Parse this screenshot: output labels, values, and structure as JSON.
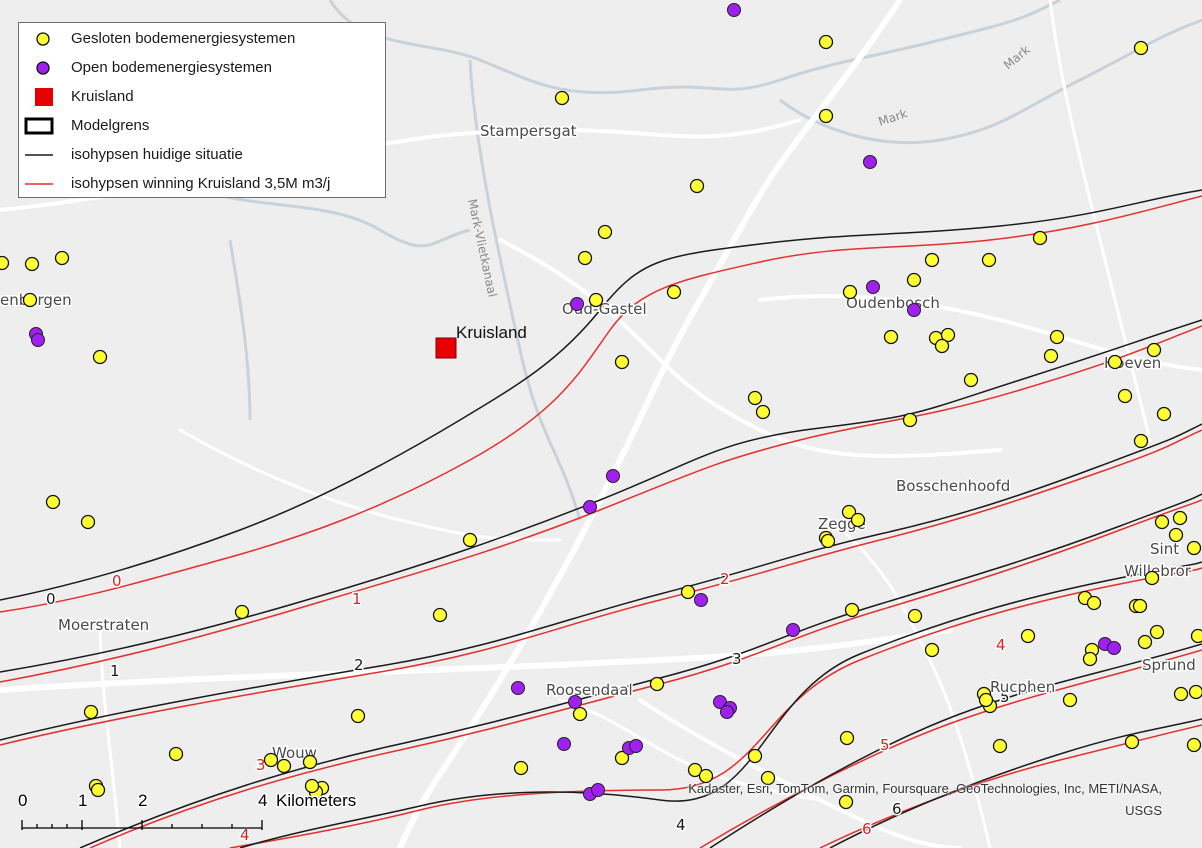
{
  "legend": {
    "items": [
      {
        "label": "Gesloten bodemenergiesystemen",
        "symbol": "yellow-circle"
      },
      {
        "label": "Open bodemenergiesystemen",
        "symbol": "purple-circle"
      },
      {
        "label": "Kruisland",
        "symbol": "red-square"
      },
      {
        "label": "Modelgrens",
        "symbol": "black-outline-box"
      },
      {
        "label": "isohypsen huidige situatie",
        "symbol": "black-line"
      },
      {
        "label": "isohypsen winning Kruisland 3,5M m3/j",
        "symbol": "red-line"
      }
    ]
  },
  "colors": {
    "background": "#eeeeee",
    "road": "#ffffff",
    "water": "#c9d2d8",
    "closed_system": "#ffff33",
    "open_system": "#a020f0",
    "kruisland": "#e60000",
    "iso_current": "#1a1a1a",
    "iso_winning": "#e62e2e"
  },
  "places": [
    {
      "name": "Stampersgat"
    },
    {
      "name": "enbergen"
    },
    {
      "name": "Oud-Gastel"
    },
    {
      "name": "Oudenbosch"
    },
    {
      "name": "Hoeven"
    },
    {
      "name": "Bosschenhoofd"
    },
    {
      "name": "Zegge"
    },
    {
      "name": "Sint"
    },
    {
      "name": "Willebror"
    },
    {
      "name": "Moerstraten"
    },
    {
      "name": "Roosendaal"
    },
    {
      "name": "Wouw"
    },
    {
      "name": "Rucphen"
    },
    {
      "name": "Sprund"
    }
  ],
  "waterway_labels": [
    "Mark",
    "Mark",
    "Mark-Vlietkanaal"
  ],
  "kruisland_label": "Kruisland",
  "isohypse_labels": [
    "0",
    "0",
    "1",
    "1",
    "2",
    "2",
    "3",
    "3",
    "4",
    "4",
    "4",
    "5",
    "5",
    "6",
    "6"
  ],
  "scale": {
    "ticks": [
      "0",
      "1",
      "2",
      "4"
    ],
    "unit": "Kilometers"
  },
  "attribution": {
    "line1": "Kadaster, Esri, TomTom, Garmin, Foursquare, GeoTechnologies, Inc, METI/NASA,",
    "line2": "USGS"
  }
}
